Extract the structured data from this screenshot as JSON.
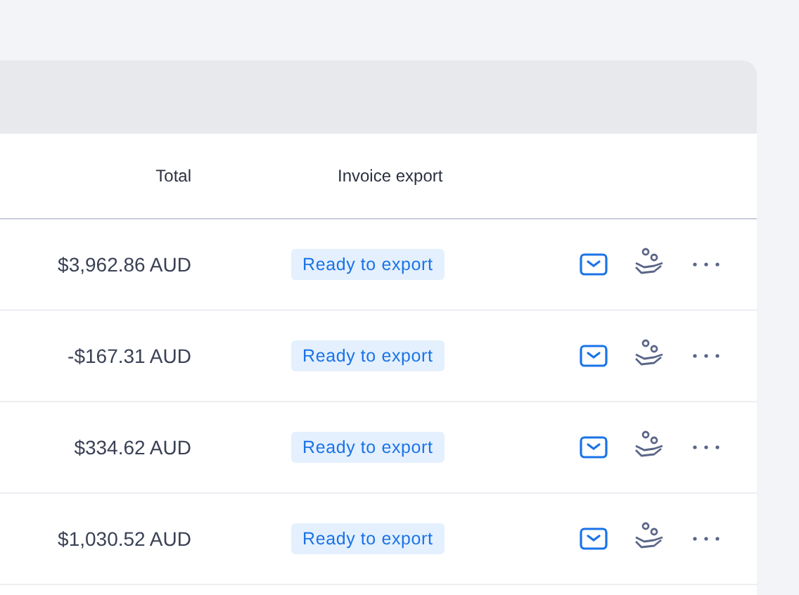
{
  "table": {
    "columns": [
      {
        "label": "Total"
      },
      {
        "label": "Invoice export"
      }
    ],
    "rows": [
      {
        "total": "$3,962.86 AUD",
        "export_status": "Ready to export"
      },
      {
        "total": "-$167.31 AUD",
        "export_status": "Ready to export"
      },
      {
        "total": "$334.62 AUD",
        "export_status": "Ready to export"
      },
      {
        "total": "$1,030.52 AUD",
        "export_status": "Ready to export"
      }
    ]
  }
}
